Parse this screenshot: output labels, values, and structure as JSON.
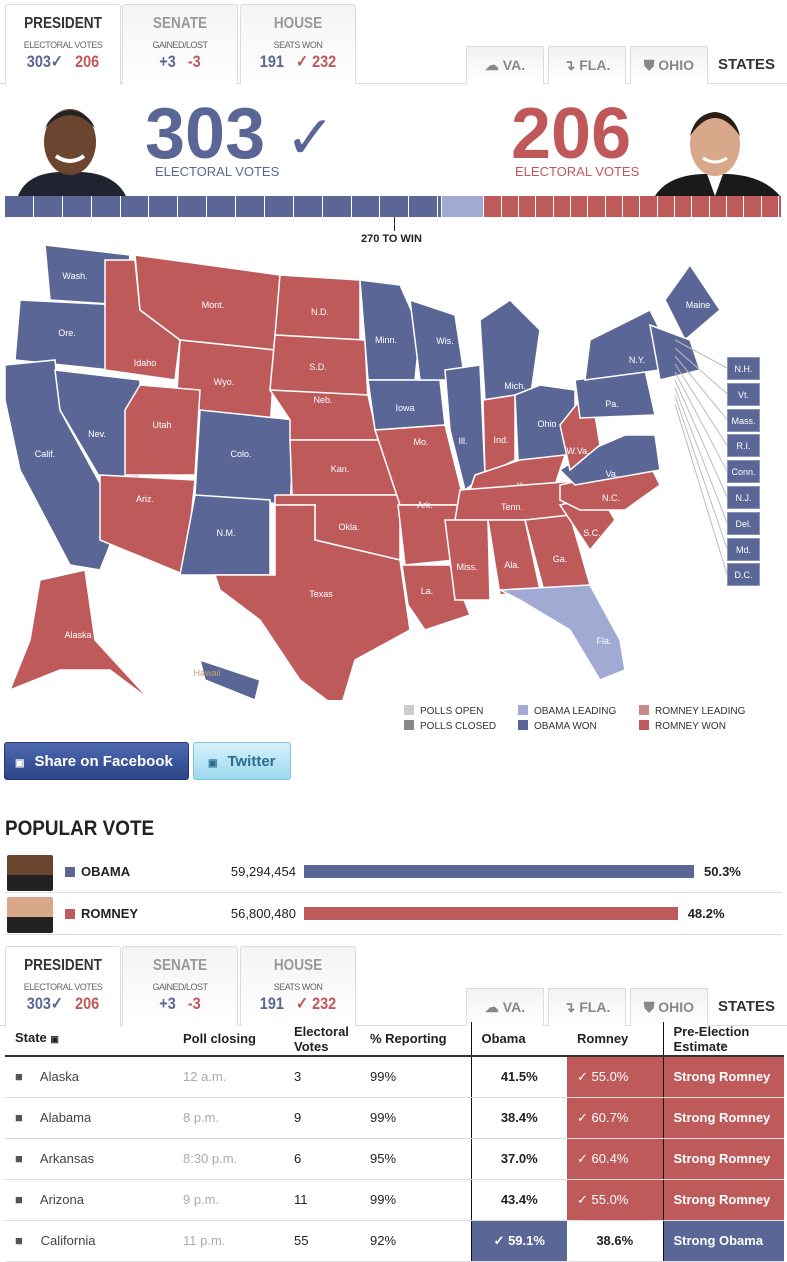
{
  "nav": {
    "tabs": [
      {
        "title": "PRESIDENT",
        "sub": "ELECTORAL VOTES",
        "left": "303✓",
        "right": "206"
      },
      {
        "title": "SENATE",
        "sub": "GAINED/LOST",
        "left": "+3",
        "right": "-3"
      },
      {
        "title": "HOUSE",
        "sub": "SEATS WON",
        "left": "191",
        "right": "✓ 232"
      }
    ],
    "state_tabs": [
      {
        "label": "VA.",
        "icon": "virginia-icon"
      },
      {
        "label": "FLA.",
        "icon": "florida-icon"
      },
      {
        "label": "OHIO",
        "icon": "ohio-icon"
      }
    ],
    "states_label": "STATES"
  },
  "summary": {
    "obama_votes": "303",
    "obama_check": "✓",
    "obama_label": "ELECTORAL VOTES",
    "romney_votes": "206",
    "romney_label": "ELECTORAL VOTES",
    "to_win": "270 TO WIN",
    "bar": {
      "obama_won": 303,
      "obama_leading": 29,
      "romney_won": 206,
      "total": 538
    }
  },
  "colors": {
    "obama_won": "#5a6796",
    "obama_leading": "#a0aad2",
    "romney_won": "#bf5a5b",
    "romney_leading": "#c98a8a",
    "polls_open": "#cccccc",
    "polls_closed": "#888888"
  },
  "map": {
    "states": [
      {
        "label": "Wash.",
        "status": "obama_won"
      },
      {
        "label": "Ore.",
        "status": "obama_won"
      },
      {
        "label": "Calif.",
        "status": "obama_won"
      },
      {
        "label": "Nev.",
        "status": "obama_won"
      },
      {
        "label": "Idaho",
        "status": "romney_won"
      },
      {
        "label": "Mont.",
        "status": "romney_won"
      },
      {
        "label": "Wyo.",
        "status": "romney_won"
      },
      {
        "label": "Utah",
        "status": "romney_won"
      },
      {
        "label": "Colo.",
        "status": "obama_won"
      },
      {
        "label": "Ariz.",
        "status": "romney_won"
      },
      {
        "label": "N.M.",
        "status": "obama_won"
      },
      {
        "label": "N.D.",
        "status": "romney_won"
      },
      {
        "label": "S.D.",
        "status": "romney_won"
      },
      {
        "label": "Neb.",
        "status": "romney_won"
      },
      {
        "label": "Kan.",
        "status": "romney_won"
      },
      {
        "label": "Okla.",
        "status": "romney_won"
      },
      {
        "label": "Texas",
        "status": "romney_won"
      },
      {
        "label": "Minn.",
        "status": "obama_won"
      },
      {
        "label": "Iowa",
        "status": "obama_won"
      },
      {
        "label": "Mo.",
        "status": "romney_won"
      },
      {
        "label": "Ark.",
        "status": "romney_won"
      },
      {
        "label": "La.",
        "status": "romney_won"
      },
      {
        "label": "Wis.",
        "status": "obama_won"
      },
      {
        "label": "Ill.",
        "status": "obama_won"
      },
      {
        "label": "Mich.",
        "status": "obama_won"
      },
      {
        "label": "Ind.",
        "status": "romney_won"
      },
      {
        "label": "Ohio",
        "status": "obama_won"
      },
      {
        "label": "Ky.",
        "status": "romney_won"
      },
      {
        "label": "Tenn.",
        "status": "romney_won"
      },
      {
        "label": "Miss.",
        "status": "romney_won"
      },
      {
        "label": "Ala.",
        "status": "romney_won"
      },
      {
        "label": "Ga.",
        "status": "romney_won"
      },
      {
        "label": "Fla.",
        "status": "obama_leading"
      },
      {
        "label": "S.C.",
        "status": "romney_won"
      },
      {
        "label": "N.C.",
        "status": "romney_won"
      },
      {
        "label": "Va.",
        "status": "obama_won"
      },
      {
        "label": "W.Va.",
        "status": "romney_won"
      },
      {
        "label": "Pa.",
        "status": "obama_won"
      },
      {
        "label": "N.Y.",
        "status": "obama_won"
      },
      {
        "label": "Maine",
        "status": "obama_won"
      },
      {
        "label": "",
        "status": "obama_won"
      },
      {
        "label": "Alaska",
        "status": "romney_won"
      },
      {
        "label": "Hawaii",
        "status": "obama_won"
      }
    ],
    "small_states": [
      "N.H.",
      "Vt.",
      "Mass.",
      "R.I.",
      "Conn.",
      "N.J.",
      "Del.",
      "Md.",
      "D.C."
    ]
  },
  "legend": [
    {
      "label": "POLLS OPEN",
      "color": "#cccccc"
    },
    {
      "label": "OBAMA LEADING",
      "color": "#a0aad2"
    },
    {
      "label": "ROMNEY LEADING",
      "color": "#c98a8a"
    },
    {
      "label": "POLLS CLOSED",
      "color": "#888888"
    },
    {
      "label": "OBAMA WON",
      "color": "#5a6796"
    },
    {
      "label": "ROMNEY WON",
      "color": "#bf5a5b"
    }
  ],
  "share": {
    "facebook": "Share on Facebook",
    "twitter": "Twitter"
  },
  "popular": {
    "title": "POPULAR VOTE",
    "rows": [
      {
        "name": "OBAMA",
        "votes": "59,294,454",
        "pct": "50.3%",
        "share": 50.3,
        "color": "#5a6796"
      },
      {
        "name": "ROMNEY",
        "votes": "56,800,480",
        "pct": "48.2%",
        "share": 48.2,
        "color": "#bf5a5b"
      }
    ]
  },
  "table": {
    "headers": [
      "State",
      "Poll closing",
      "Electoral Votes",
      "% Reporting",
      "Obama",
      "Romney",
      "Pre-Election Estimate"
    ],
    "rows": [
      {
        "state": "Alaska",
        "close": "12 a.m.",
        "ev": "3",
        "rep": "99%",
        "obama": "41.5%",
        "romney": "✓ 55.0%",
        "est": "Strong Romney",
        "winner": "romney"
      },
      {
        "state": "Alabama",
        "close": "8 p.m.",
        "ev": "9",
        "rep": "99%",
        "obama": "38.4%",
        "romney": "✓ 60.7%",
        "est": "Strong Romney",
        "winner": "romney"
      },
      {
        "state": "Arkansas",
        "close": "8:30 p.m.",
        "ev": "6",
        "rep": "95%",
        "obama": "37.0%",
        "romney": "✓ 60.4%",
        "est": "Strong Romney",
        "winner": "romney"
      },
      {
        "state": "Arizona",
        "close": "9 p.m.",
        "ev": "11",
        "rep": "99%",
        "obama": "43.4%",
        "romney": "✓ 55.0%",
        "est": "Strong Romney",
        "winner": "romney"
      },
      {
        "state": "California",
        "close": "11 p.m.",
        "ev": "55",
        "rep": "92%",
        "obama": "✓ 59.1%",
        "romney": "38.6%",
        "est": "Strong Obama",
        "winner": "obama"
      }
    ]
  }
}
